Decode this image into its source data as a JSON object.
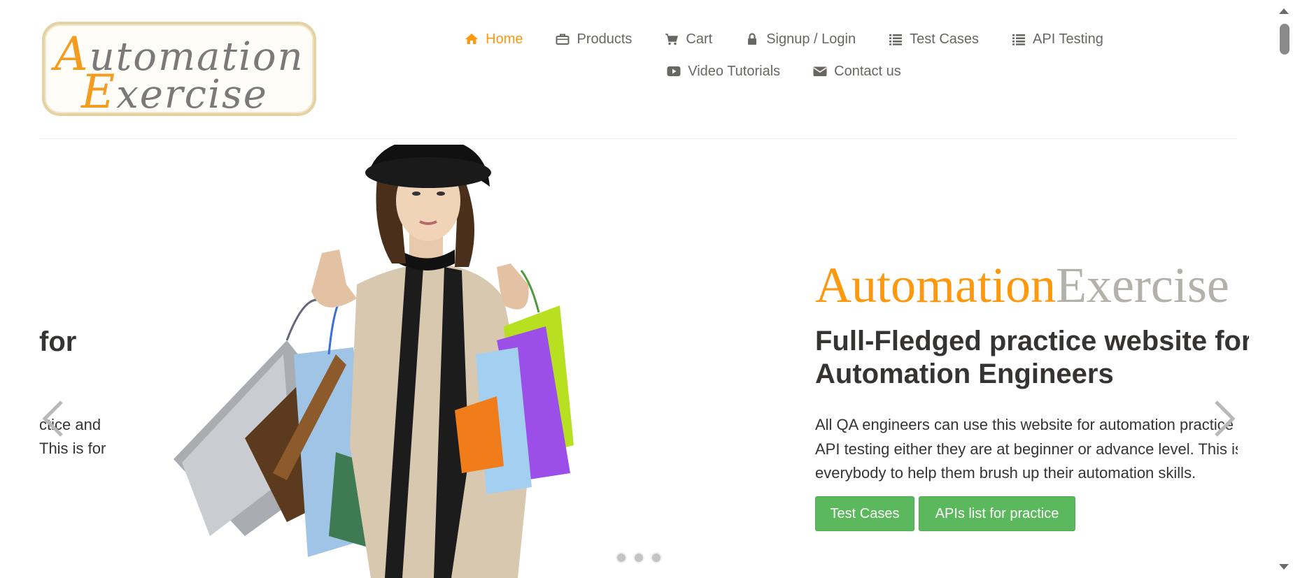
{
  "logo": {
    "line1_cap": "A",
    "line1_rest": "utomation",
    "line2_cap": "E",
    "line2_rest": "xercise"
  },
  "nav": {
    "items": [
      {
        "label": "Home",
        "icon": "home-icon",
        "active": true
      },
      {
        "label": "Products",
        "icon": "briefcase-icon"
      },
      {
        "label": "Cart",
        "icon": "cart-icon"
      },
      {
        "label": "Signup / Login",
        "icon": "lock-icon"
      },
      {
        "label": "Test Cases",
        "icon": "list-icon"
      },
      {
        "label": "API Testing",
        "icon": "list-icon"
      },
      {
        "label": "Video Tutorials",
        "icon": "youtube-play-icon"
      },
      {
        "label": "Contact us",
        "icon": "envelope-icon"
      }
    ]
  },
  "slider": {
    "peek": {
      "title": "for",
      "line1": "ctice and",
      "line2": "This is for"
    },
    "brand_part1": "Automation",
    "brand_part2": "Exercise",
    "heading_line1": "Full-Fledged practice website for",
    "heading_line2": "Automation Engineers",
    "text_line1": "All QA engineers can use this website for automation practice and",
    "text_line2": "API testing either they are at beginner or advance level. This is for",
    "text_line3": "everybody to help them brush up their automation skills.",
    "btn_test_cases": "Test Cases",
    "btn_apis": "APIs list for practice",
    "dots_count": 3
  },
  "colors": {
    "accent": "#fe980f",
    "text": "#696763",
    "dark_text": "#363432",
    "button_green": "#5cb85c"
  }
}
